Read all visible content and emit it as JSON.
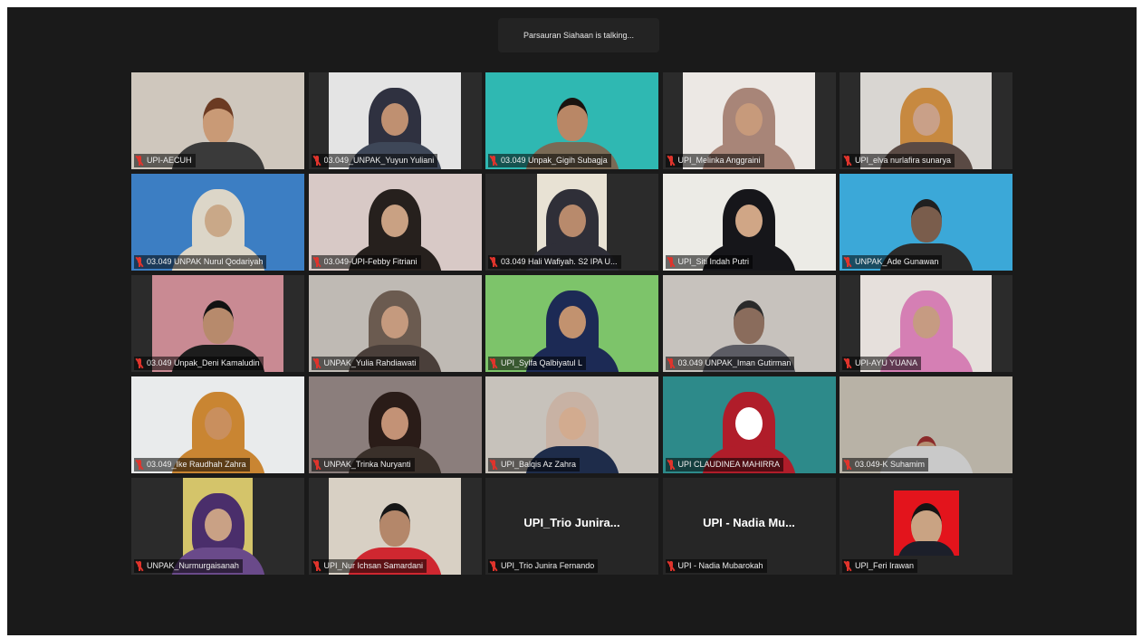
{
  "status": {
    "talking": "Parsauran Siahaan is talking..."
  },
  "participants": [
    {
      "name": "UPI-AECUH",
      "bg": "#cfc7bd",
      "skin": "#c99a76",
      "hair": "#6b3a22",
      "shirt": "#3a3a3a",
      "style": "cap"
    },
    {
      "name": "03.049_UNPAK_Yuyun Yuliani",
      "bg": "#e4e4e4",
      "skin": "#bf9071",
      "hair": "#2f3140",
      "shirt": "#3e4758",
      "style": "veil"
    },
    {
      "name": "03.049 Unpak_Gigih Subagja",
      "bg": "#2fb8b2",
      "skin": "#b98766",
      "hair": "#1a1410",
      "shirt": "#7a6a55",
      "style": "man"
    },
    {
      "name": "UPI_Melinka Anggraini",
      "bg": "#ece8e4",
      "skin": "#c79a7b",
      "hair": "#a88578",
      "shirt": "#a88578",
      "style": "veil"
    },
    {
      "name": "UPI_elva nurlafira sunarya",
      "bg": "#d9d6d2",
      "skin": "#c9a088",
      "hair": "#c78940",
      "shirt": "#5a4a44",
      "style": "veil"
    },
    {
      "name": "03.049 UNPAK Nurul Qodariyah",
      "bg": "#3c7ec3",
      "skin": "#c9a888",
      "hair": "#dcd6c8",
      "shirt": "#dcd6c8",
      "style": "veil"
    },
    {
      "name": "03.049-UPI-Febby Fitriani",
      "bg": "#d8c9c6",
      "skin": "#c9a183",
      "hair": "#26201d",
      "shirt": "#26201d",
      "style": "veil"
    },
    {
      "name": "03.049 Hali Wafiyah. S2 IPA U...",
      "bg": "#e8e2d4",
      "skin": "#b88a6c",
      "hair": "#2f2f38",
      "shirt": "#2f2f38",
      "style": "veil"
    },
    {
      "name": "UPI_Siti Indah Putri",
      "bg": "#ecebe6",
      "skin": "#d0a686",
      "hair": "#16161a",
      "shirt": "#16161a",
      "style": "veil"
    },
    {
      "name": "UNPAK_Ade Gunawan",
      "bg": "#3ba8d8",
      "skin": "#7a5d4c",
      "hair": "#202020",
      "shirt": "#2b2b2b",
      "style": "man"
    },
    {
      "name": "03.049 Unpak_Deni Kamaludin",
      "bg": "#c98a93",
      "skin": "#b78a6c",
      "hair": "#121212",
      "shirt": "#1d1d1d",
      "style": "man"
    },
    {
      "name": "UNPAK_Yulia Rahdiawati",
      "bg": "#bfbab4",
      "skin": "#c59a7e",
      "hair": "#6b5b50",
      "shirt": "#4a3f3a",
      "style": "veil"
    },
    {
      "name": "UPI_Sylfa Qalbiyatul L",
      "bg": "#7dc46a",
      "skin": "#c2926f",
      "hair": "#1c2a55",
      "shirt": "#1c2a55",
      "style": "veil"
    },
    {
      "name": "03.049 UNPAK_Iman Gutirman",
      "bg": "#c7c2bd",
      "skin": "#8a6c5c",
      "hair": "#2a2a2a",
      "shirt": "#5c5c64",
      "style": "man"
    },
    {
      "name": "UPI-AYU YUANA",
      "bg": "#e6e0dc",
      "skin": "#c69b82",
      "hair": "#d57fb4",
      "shirt": "#d57fb4",
      "style": "veil"
    },
    {
      "name": "03.049_Ike Raudhah Zahra",
      "bg": "#e9ebec",
      "skin": "#c98f5e",
      "hair": "#c98532",
      "shirt": "#c98532",
      "style": "veil"
    },
    {
      "name": "UNPAK_Trinka Nuryanti",
      "bg": "#8b7e7c",
      "skin": "#c39276",
      "hair": "#2a1c18",
      "shirt": "#3a302a",
      "style": "woman"
    },
    {
      "name": "UPI_Balqis Az Zahra",
      "bg": "#c7c2bb",
      "skin": "#d2ab8f",
      "hair": "#c8b2a4",
      "shirt": "#1e2c4a",
      "style": "veil"
    },
    {
      "name": "UPI CLAUDINEA MAHIRRA",
      "bg": "#2d8a8a",
      "skin": "#ffffff",
      "hair": "#b01d2a",
      "shirt": "#b01d2a",
      "style": "veil"
    },
    {
      "name": "03.049-K Suhamim",
      "bg": "#b8b2a6",
      "skin": "#b58f72",
      "hair": "#8b2a2a",
      "shirt": "#c9c9c9",
      "style": "small"
    },
    {
      "name": "UNPAK_Nurmurgaisanah",
      "bg": "#d4c46a",
      "skin": "#c9a185",
      "hair": "#4a2e6b",
      "shirt": "#6a4a8a",
      "style": "woman"
    },
    {
      "name": "UPI_Nur Ichsan Samardani",
      "bg": "#d8d0c4",
      "skin": "#b4876a",
      "hair": "#161616",
      "shirt": "#cf2730",
      "style": "man"
    },
    {
      "name": "UPI_Trio Junira Fernando",
      "big": "UPI_Trio  Junira...",
      "style": "nocam"
    },
    {
      "name": "UPI - Nadia Mubarokah",
      "big": "UPI  -  Nadia  Mu...",
      "style": "nocam"
    },
    {
      "name": "UPI_Feri Irawan",
      "bg": "#e3141c",
      "skin": "#c9a383",
      "hair": "#141414",
      "shirt": "#1c1f2a",
      "style": "photo"
    }
  ]
}
